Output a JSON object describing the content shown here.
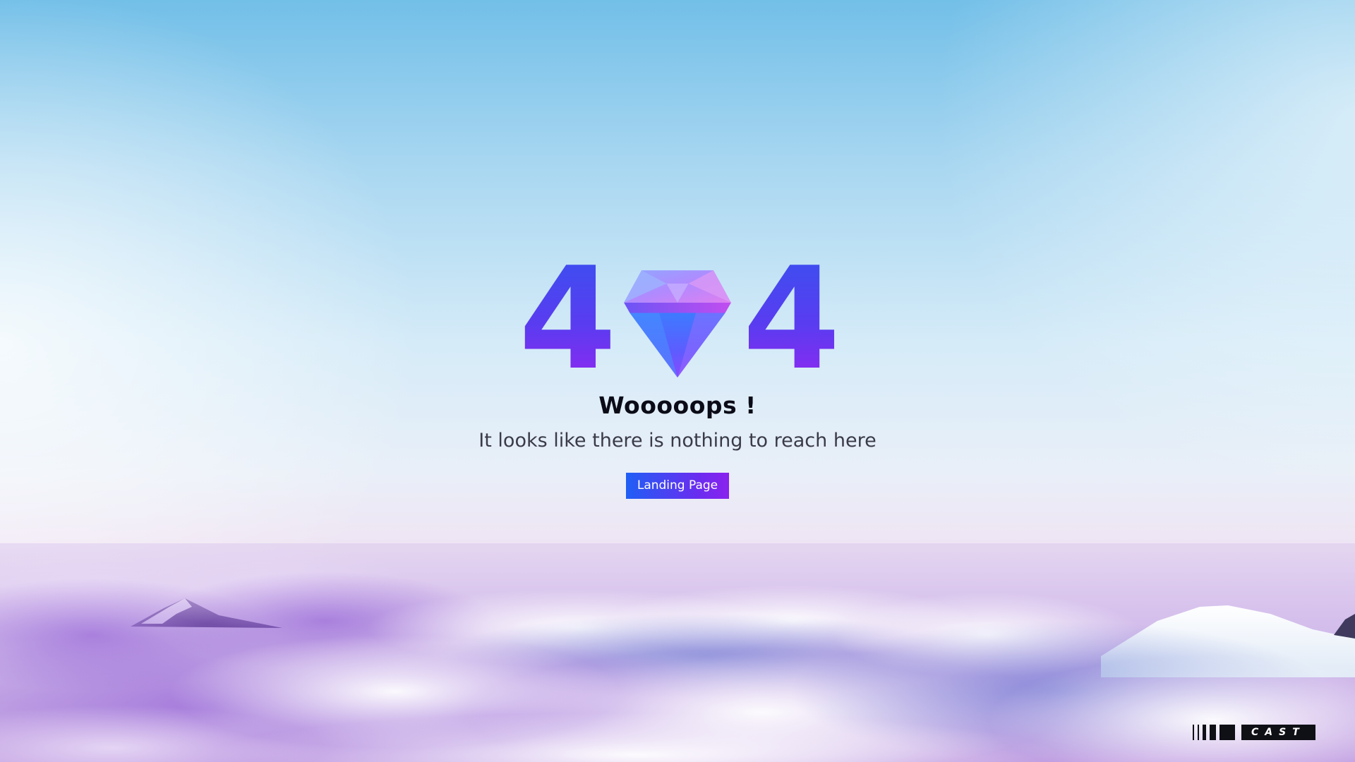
{
  "error": {
    "digit_left": "4",
    "digit_right": "4",
    "headline": "Wooooops !",
    "message": "It looks like there is nothing to reach here"
  },
  "actions": {
    "landing_label": "Landing Page"
  },
  "brand": {
    "name": "CAST"
  },
  "colors": {
    "accent_start": "#1f5ff5",
    "accent_end": "#8a22ee",
    "digit_top": "#3e4df0",
    "digit_bottom": "#8a2af0",
    "headline": "#0b0b18"
  },
  "icons": {
    "gem": "diamond-icon",
    "brand_bars": "barcode-bars-icon"
  }
}
